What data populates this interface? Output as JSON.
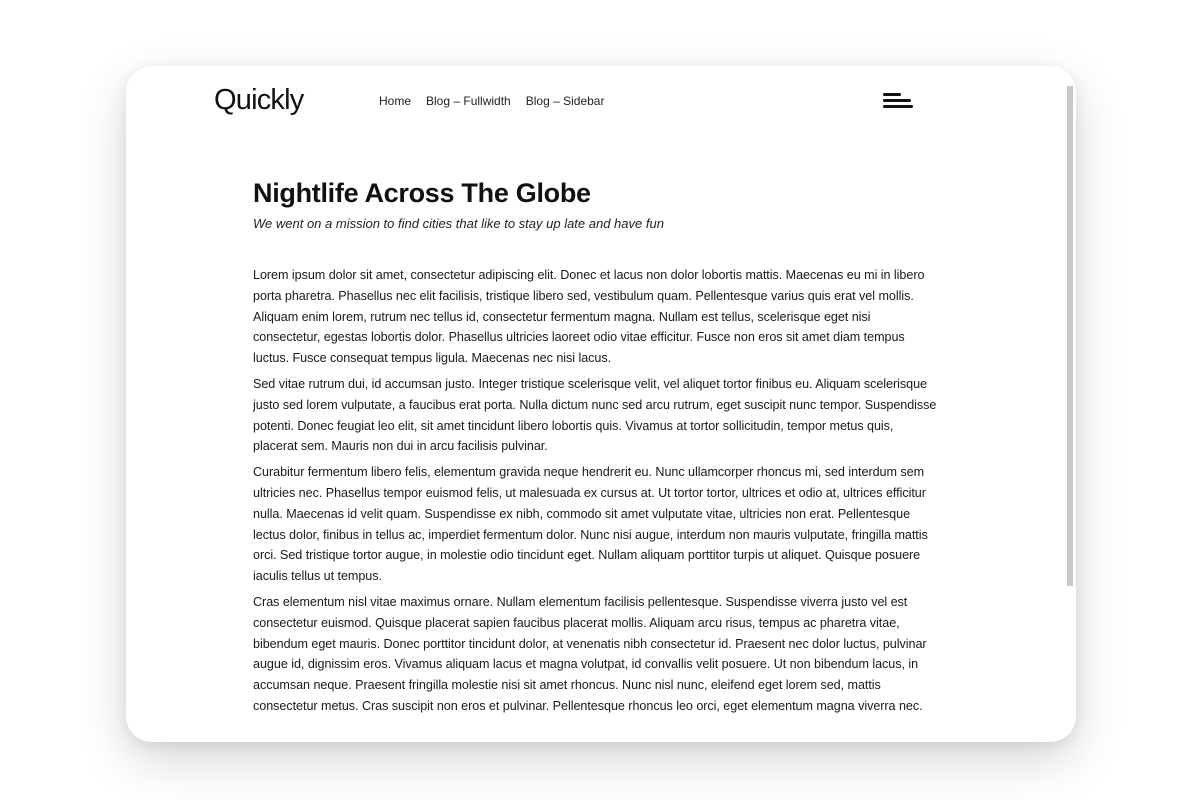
{
  "site": {
    "logo": "Quickly"
  },
  "nav": {
    "items": [
      {
        "label": "Home"
      },
      {
        "label": "Blog – Fullwidth"
      },
      {
        "label": "Blog – Sidebar"
      }
    ],
    "menu_icon": "hamburger-menu-icon"
  },
  "article": {
    "title": "Nightlife Across The Globe",
    "subtitle": "We went on a mission to find cities that like to stay up late and have fun",
    "paragraphs": [
      "Lorem ipsum dolor sit amet, consectetur adipiscing elit. Donec et lacus non dolor lobortis mattis. Maecenas eu mi in libero porta pharetra. Phasellus nec elit facilisis, tristique libero sed, vestibulum quam. Pellentesque varius quis erat vel mollis. Aliquam enim lorem, rutrum nec tellus id, consectetur fermentum magna. Nullam est tellus, scelerisque eget nisi consectetur, egestas lobortis dolor. Phasellus ultricies laoreet odio vitae efficitur. Fusce non eros sit amet diam tempus luctus. Fusce consequat tempus ligula. Maecenas nec nisi lacus.",
      "Sed vitae rutrum dui, id accumsan justo. Integer tristique scelerisque velit, vel aliquet tortor finibus eu. Aliquam scelerisque justo sed lorem vulputate, a faucibus erat porta. Nulla dictum nunc sed arcu rutrum, eget suscipit nunc tempor. Suspendisse potenti. Donec feugiat leo elit, sit amet tincidunt libero lobortis quis. Vivamus at tortor sollicitudin, tempor metus quis, placerat sem. Mauris non dui in arcu facilisis pulvinar.",
      "Curabitur fermentum libero felis, elementum gravida neque hendrerit eu. Nunc ullamcorper rhoncus mi, sed interdum sem ultricies nec. Phasellus tempor euismod felis, ut malesuada ex cursus at. Ut tortor tortor, ultrices et odio at, ultrices efficitur nulla. Maecenas id velit quam. Suspendisse ex nibh, commodo sit amet vulputate vitae, ultricies non erat. Pellentesque lectus dolor, finibus in tellus ac, imperdiet fermentum dolor. Nunc nisi augue, interdum non mauris vulputate, fringilla mattis orci. Sed tristique tortor augue, in molestie odio tincidunt eget. Nullam aliquam porttitor turpis ut aliquet. Quisque posuere iaculis tellus ut tempus.",
      "Cras elementum nisl vitae maximus ornare. Nullam elementum facilisis pellentesque. Suspendisse viverra justo vel est consectetur euismod. Quisque placerat sapien faucibus placerat mollis. Aliquam arcu risus, tempus ac pharetra vitae, bibendum eget mauris. Donec porttitor tincidunt dolor, at venenatis nibh consectetur id. Praesent nec dolor luctus, pulvinar augue id, dignissim eros. Vivamus aliquam lacus et magna volutpat, id convallis velit posuere. Ut non bibendum lacus, in accumsan neque. Praesent fringilla molestie nisi sit amet rhoncus. Nunc nisl nunc, eleifend eget lorem sed, mattis consectetur metus. Cras suscipit non eros et pulvinar. Pellentesque rhoncus leo orci, eget elementum magna viverra nec."
    ]
  }
}
